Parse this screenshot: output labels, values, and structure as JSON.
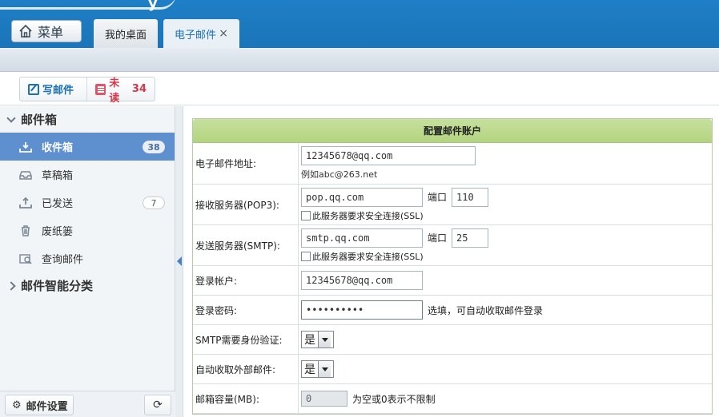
{
  "header": {
    "menu_label": "菜单",
    "tabs": [
      {
        "label": "我的桌面"
      },
      {
        "label": "电子邮件",
        "close": "×"
      }
    ]
  },
  "toolbar": {
    "compose_label": "写邮件",
    "unread_label": "未读",
    "unread_count": "34"
  },
  "sidebar": {
    "mailbox_section": "邮件箱",
    "items": [
      {
        "label": "收件箱",
        "badge": "38",
        "icon": "inbox-icon"
      },
      {
        "label": "草稿箱",
        "icon": "drafts-icon"
      },
      {
        "label": "已发送",
        "badge": "7",
        "icon": "sent-icon"
      },
      {
        "label": "废纸篓",
        "icon": "trash-icon"
      },
      {
        "label": "查询邮件",
        "icon": "search-mail-icon"
      }
    ],
    "smart_section": "邮件智能分类",
    "settings_label": "邮件设置"
  },
  "form": {
    "title": "配置邮件账户",
    "email": {
      "label": "电子邮件地址:",
      "value": "12345678@qq.com",
      "hint": "例如abc@263.net"
    },
    "pop3": {
      "label": "接收服务器(POP3):",
      "server": "pop.qq.com",
      "port_label": "端口",
      "port": "110",
      "ssl": "此服务器要求安全连接(SSL)"
    },
    "smtp": {
      "label": "发送服务器(SMTP):",
      "server": "smtp.qq.com",
      "port_label": "端口",
      "port": "25",
      "ssl": "此服务器要求安全连接(SSL)"
    },
    "account": {
      "label": "登录帐户:",
      "value": "12345678@qq.com"
    },
    "password": {
      "label": "登录密码:",
      "value": "••••••••••",
      "note": "选填，可自动收取邮件登录"
    },
    "smtp_auth": {
      "label": "SMTP需要身份验证:",
      "value": "是"
    },
    "auto_fetch": {
      "label": "自动收取外部邮件:",
      "value": "是"
    },
    "quota": {
      "label": "邮箱容量(MB):",
      "value": "0",
      "note": "为空或0表示不限制"
    }
  },
  "colors": {
    "header_blue": "#1b74b8",
    "active_item": "#5e8fcf",
    "form_header_green": "#b4d47f",
    "unread_red": "#d4384a"
  }
}
